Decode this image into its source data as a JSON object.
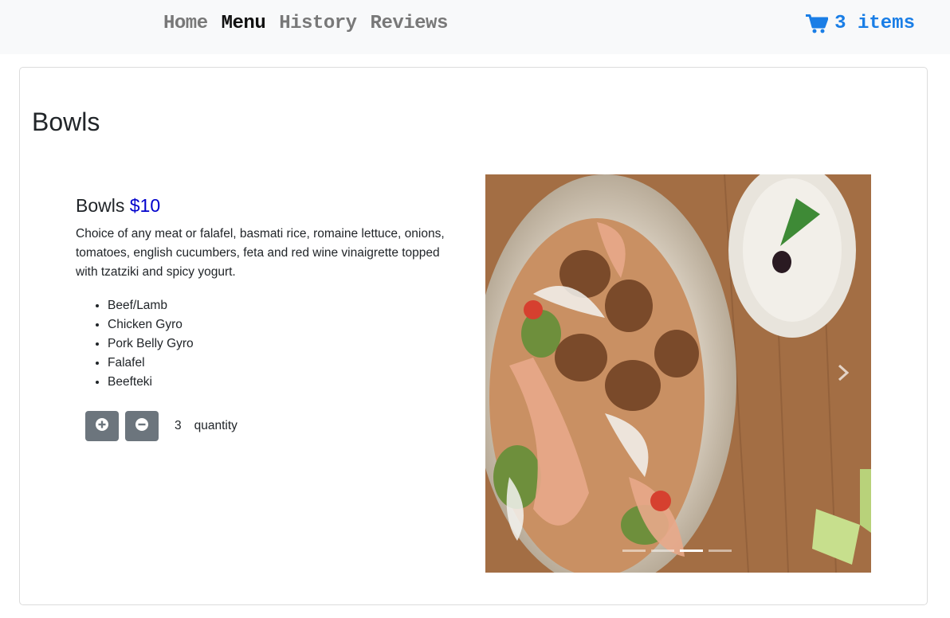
{
  "nav": {
    "links": [
      {
        "label": "Home",
        "active": false
      },
      {
        "label": "Menu",
        "active": true
      },
      {
        "label": "History",
        "active": false
      },
      {
        "label": "Reviews",
        "active": false
      }
    ],
    "cart_label": "3 items",
    "cart_icon": "shopping-cart-icon"
  },
  "section": {
    "title": "Bowls"
  },
  "item": {
    "name": "Bowls",
    "price": "$10",
    "description": "Choice of any meat or falafel, basmati rice, romaine lettuce, onions, tomatoes, english cucumbers, feta and red wine vinaigrette topped with tzatziki and spicy yogurt.",
    "options": [
      "Beef/Lamb",
      "Chicken Gyro",
      "Pork Belly Gyro",
      "Falafel",
      "Beefteki"
    ],
    "quantity": "3",
    "quantity_label": "quantity"
  },
  "carousel": {
    "slide_count": 4,
    "active_index": 2
  },
  "colors": {
    "navbar_bg": "#f8f9fa",
    "cart": "#1a7ee6",
    "price": "#0000cc",
    "button": "#6c757d"
  }
}
